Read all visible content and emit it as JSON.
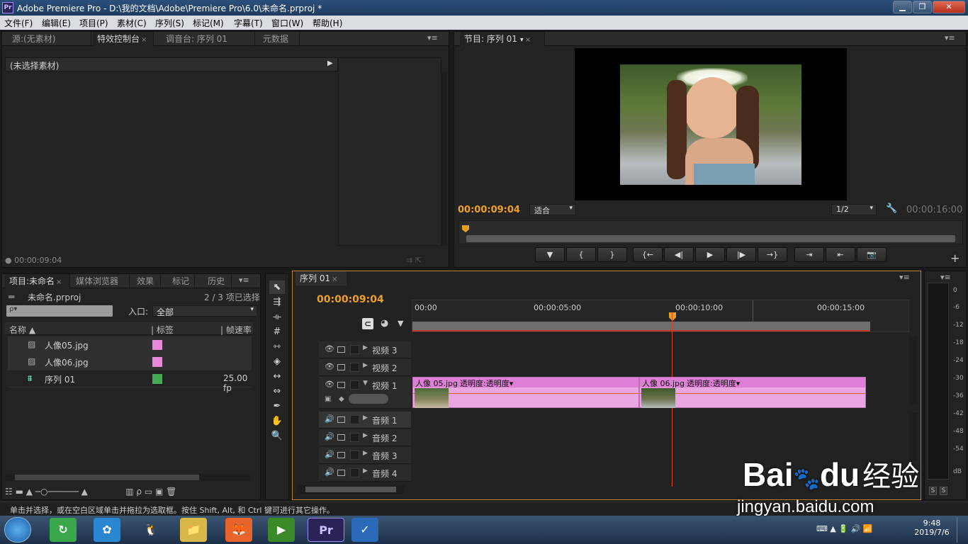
{
  "window": {
    "title": "Adobe Premiere Pro - D:\\我的文档\\Adobe\\Premiere Pro\\6.0\\未命名.prproj *",
    "min": "▁",
    "max": "❐",
    "close": "✕"
  },
  "menu": [
    "文件(F)",
    "编辑(E)",
    "项目(P)",
    "素材(C)",
    "序列(S)",
    "标记(M)",
    "字幕(T)",
    "窗口(W)",
    "帮助(H)"
  ],
  "source_panel": {
    "tabs": [
      "源:(无素材)",
      "特效控制台",
      "调音台: 序列 01",
      "元数据"
    ],
    "no_clip": "(未选择素材)",
    "timecode": "00:00:09:04"
  },
  "program_monitor": {
    "tab": "节目: 序列 01",
    "timecode": "00:00:09:04",
    "fit": "适合",
    "resolution": "1/2",
    "duration": "00:00:16:00",
    "controls": [
      "▼",
      "{",
      "}",
      "{←",
      "◀|",
      "▶",
      "|▶",
      "→}",
      "⇥",
      "⇤",
      "📷"
    ]
  },
  "project_panel": {
    "tabs": [
      "项目:未命名",
      "媒体浏览器",
      "效果",
      "标记",
      "历史"
    ],
    "file": "未命名.prproj",
    "selection": "2 / 3 项已选择",
    "search_placeholder": "ρ▾",
    "in_label": "入口:",
    "in_value": "全部",
    "headers": [
      "名称",
      "标签",
      "帧速率"
    ],
    "items": [
      {
        "name": "人像05.jpg",
        "color": "#e888d8",
        "fps": ""
      },
      {
        "name": "人像06.jpg",
        "color": "#e888d8",
        "fps": ""
      },
      {
        "name": "序列 01",
        "color": "#44aa55",
        "fps": "25.00 fp"
      }
    ]
  },
  "timeline": {
    "tab": "序列 01",
    "timecode": "00:00:09:04",
    "ruler": [
      "00:00",
      "00:00:05:00",
      "00:00:10:00",
      "00:00:15:00"
    ],
    "video_tracks": [
      "视频 3",
      "视频 2",
      "视频 1"
    ],
    "audio_tracks": [
      "音频 1",
      "音频 2",
      "音频 3",
      "音频 4"
    ],
    "clips": [
      {
        "name": "人像 05.jpg",
        "fx": "透明度:透明度▾"
      },
      {
        "name": "人像 06.jpg",
        "fx": "透明度:透明度▾"
      }
    ]
  },
  "audio_meter": {
    "labels": [
      "0",
      "-6",
      "-12",
      "-18",
      "-24",
      "-30",
      "-36",
      "-42",
      "-48",
      "-54",
      "dB"
    ],
    "solo": [
      "S",
      "S"
    ]
  },
  "status_bar": "单击并选择，或在空白区域单击并拖拉为选取框。按住 Shift, Alt, 和 Ctrl 键可进行其它操作。",
  "taskbar": {
    "apps": [
      "↻",
      "✿",
      "🐧",
      "📁",
      "🦊",
      "▶",
      "Pr",
      "✓"
    ],
    "time": "9:48",
    "date": "2019/7/6",
    "tray": [
      "⌨",
      "▲",
      "🔋",
      "🔊",
      "📶"
    ]
  },
  "watermark": {
    "brand": "Bai",
    "brand2": "du",
    "cn": "经验",
    "url": "jingyan.baidu.com"
  }
}
